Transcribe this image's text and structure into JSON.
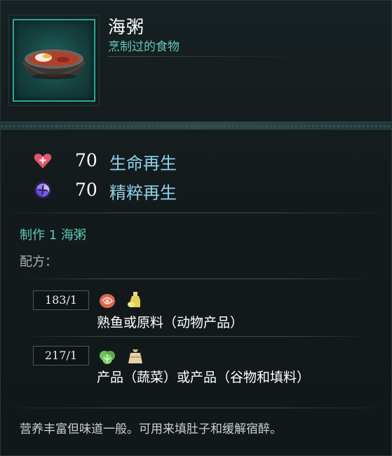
{
  "item": {
    "title": "海粥",
    "subtitle": "烹制过的食物",
    "icon": "porridge-bowl-icon"
  },
  "stats": [
    {
      "icon": "health-heart-icon",
      "value": "70",
      "label": "生命再生",
      "color": "#e0566a"
    },
    {
      "icon": "essence-swirl-icon",
      "value": "70",
      "label": "精粹再生",
      "color": "#8a6cf0"
    }
  ],
  "craft": {
    "title": "制作 1 海粥",
    "recipe_label": "配方："
  },
  "ingredients": [
    {
      "qty": "183/1",
      "icons": [
        "meat-icon",
        "oil-bottle-icon"
      ],
      "name": "熟鱼或原料（动物产品）"
    },
    {
      "qty": "217/1",
      "icons": [
        "vegetable-icon",
        "grain-sack-icon"
      ],
      "name": "产品（蔬菜）或产品（谷物和填料）"
    }
  ],
  "description": "营养丰富但味道一般。可用来填肚子和缓解宿醉。",
  "colors": {
    "accent": "#5fc6b7",
    "stat_label": "#8fd0ea",
    "frame": "#2aa699"
  }
}
